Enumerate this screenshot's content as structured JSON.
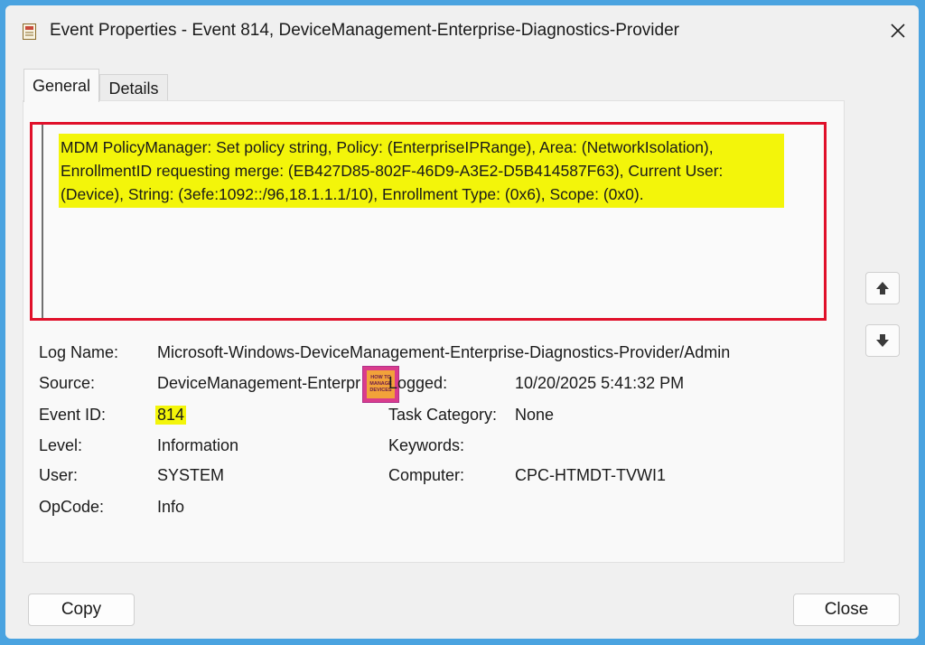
{
  "window": {
    "title": "Event Properties - Event 814, DeviceManagement-Enterprise-Diagnostics-Provider"
  },
  "tabs": [
    {
      "label": "General",
      "active": true
    },
    {
      "label": "Details",
      "active": false
    }
  ],
  "description": "MDM PolicyManager: Set policy string, Policy: (EnterpriseIPRange), Area: (NetworkIsolation), EnrollmentID requesting merge: (EB427D85-802F-46D9-A3E2-D5B414587F63), Current User: (Device), String: (3efe:1092::/96,18.1.1.1/10), Enrollment Type: (0x6), Scope: (0x0).",
  "watermark": {
    "line1": "HOW TO",
    "line2": "MANAGE",
    "line3": "DEVICES"
  },
  "fields": {
    "log_name": {
      "label": "Log Name:",
      "value": "Microsoft-Windows-DeviceManagement-Enterprise-Diagnostics-Provider/Admin"
    },
    "source": {
      "label": "Source:",
      "value": "DeviceManagement-Enterpr"
    },
    "logged": {
      "label": "Logged:",
      "value": "10/20/2025 5:41:32 PM"
    },
    "event_id": {
      "label": "Event ID:",
      "value": "814"
    },
    "task_category": {
      "label": "Task Category:",
      "value": "None"
    },
    "level": {
      "label": "Level:",
      "value": "Information"
    },
    "keywords": {
      "label": "Keywords:",
      "value": ""
    },
    "user": {
      "label": "User:",
      "value": "SYSTEM"
    },
    "computer": {
      "label": "Computer:",
      "value": "CPC-HTMDT-TVWI1"
    },
    "opcode": {
      "label": "OpCode:",
      "value": "Info"
    }
  },
  "buttons": {
    "copy": "Copy",
    "close": "Close"
  },
  "colors": {
    "highlight": "#f3f50a",
    "annotation_border": "#e0102a",
    "frame": "#4aa3e0"
  }
}
